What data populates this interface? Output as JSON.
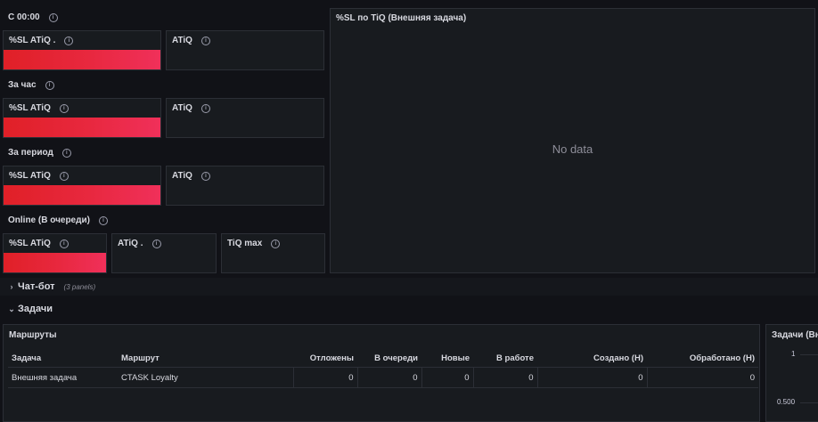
{
  "top": {
    "section_c0000": "С 00:00",
    "section_hour": "За час",
    "section_period": "За период",
    "section_online": "Online (В очереди)",
    "stat_sl_atiq_dot": "%SL ATiQ .",
    "stat_sl_atiq": "%SL ATiQ",
    "stat_atiq": "ATiQ",
    "stat_atiq_dot": "ATiQ .",
    "stat_tiq_max": "TiQ max"
  },
  "graph_panel": {
    "title": "%SL по TiQ (Внешняя задача)",
    "no_data": "No data"
  },
  "rows": {
    "chatbot": {
      "title": "Чат-бот",
      "panels": "(3 panels)",
      "collapsed": true
    },
    "tasks": {
      "title": "Задачи",
      "collapsed": false
    }
  },
  "routes_table": {
    "title": "Маршруты",
    "columns": [
      "Задача",
      "Маршрут",
      "Отложены",
      "В очереди",
      "Новые",
      "В работе",
      "Создано (Н)",
      "Обработано (Н)"
    ],
    "rows": [
      [
        "Внешняя задача",
        "CTASK Loyalty",
        "0",
        "0",
        "0",
        "0",
        "0",
        "0"
      ]
    ]
  },
  "side_panel": {
    "title": "Задачи (Вн",
    "y_ticks": [
      "1",
      "0.500"
    ]
  },
  "colors": {
    "background": "#111217",
    "panel": "#181b1f",
    "border": "#2c2f36",
    "stat_red": "#e02027",
    "stat_pink": "#f0305a"
  },
  "icons": {
    "info": "info-circle-icon",
    "chevron_right": "chevron-right-icon",
    "chevron_down": "chevron-down-icon"
  }
}
